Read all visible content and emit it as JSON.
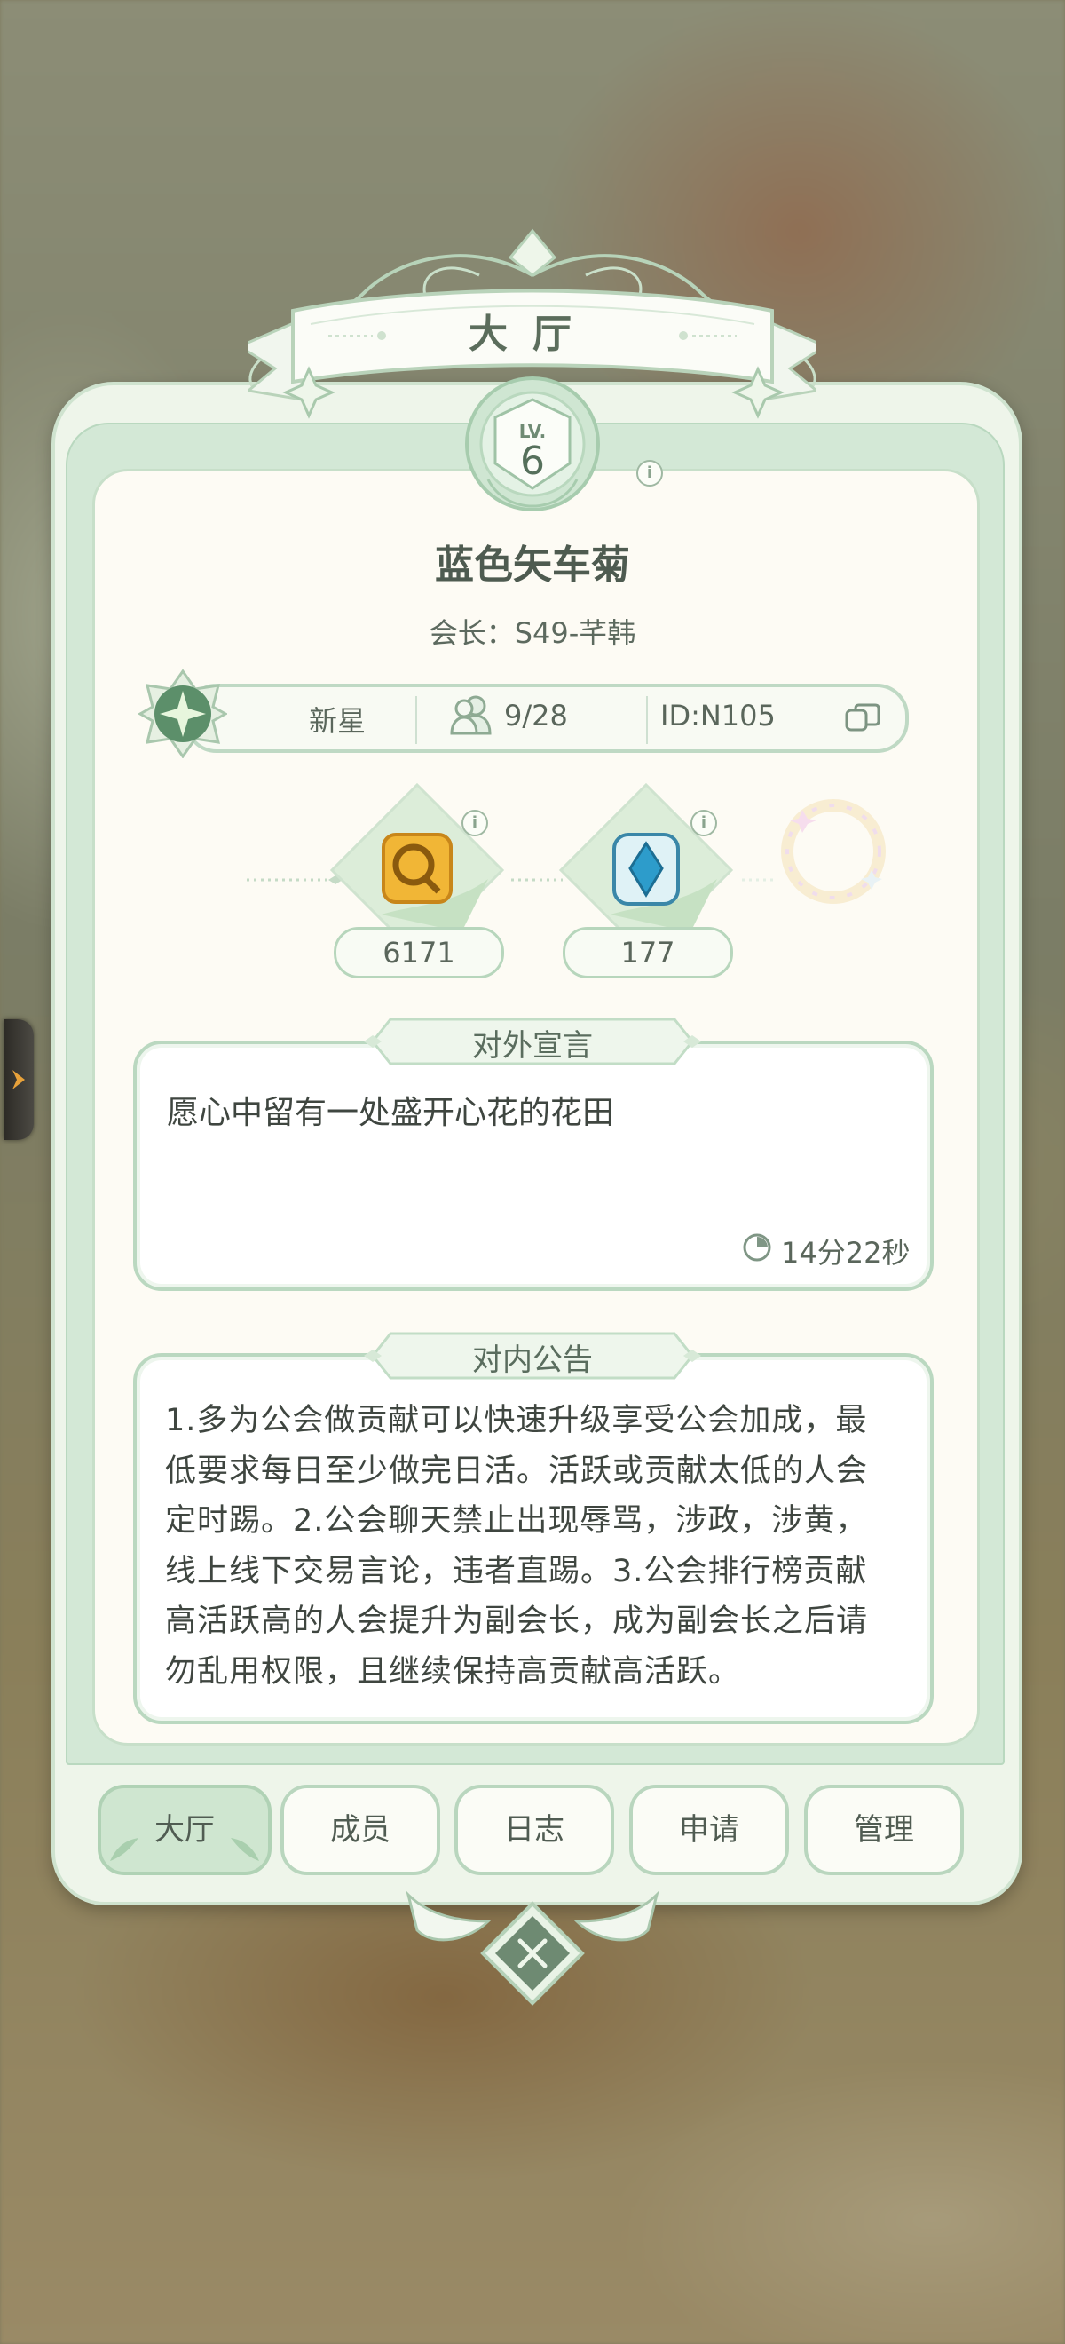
{
  "panel": {
    "title": "大厅",
    "level_prefix": "LV.",
    "level": "6"
  },
  "guild": {
    "name": "蓝色矢车菊",
    "leader_line": "会长：S49-芊韩",
    "rank": "新星",
    "members": "9/28",
    "id": "ID:N105"
  },
  "currencies": [
    {
      "icon": "gold-key-token-icon",
      "value": "6171"
    },
    {
      "icon": "blue-crystal-icon",
      "value": "177"
    }
  ],
  "declaration": {
    "label": "对外宣言",
    "text": "愿心中留有一处盛开心花的花田",
    "timer": "14分22秒"
  },
  "notice": {
    "label": "对内公告",
    "lines": [
      "1.多为公会做贡献可以快速升级享受公会加成，最",
      "低要求每日至少做完日活。活跃或贡献太低的人会",
      "定时踢。2.公会聊天禁止出现辱骂，涉政，涉黄，",
      "线上线下交易言论，违者直踢。3.公会排行榜贡献",
      "高活跃高的人会提升为副会长，成为副会长之后请",
      "勿乱用权限，且继续保持高贡献高活跃。"
    ]
  },
  "tabs": [
    {
      "label": "大厅",
      "active": true
    },
    {
      "label": "成员",
      "active": false
    },
    {
      "label": "日志",
      "active": false
    },
    {
      "label": "申请",
      "active": false
    },
    {
      "label": "管理",
      "active": false
    }
  ],
  "colors": {
    "accent": "#bad8c0",
    "text": "#4e5b50",
    "active_tab": "#cfe6d0"
  }
}
